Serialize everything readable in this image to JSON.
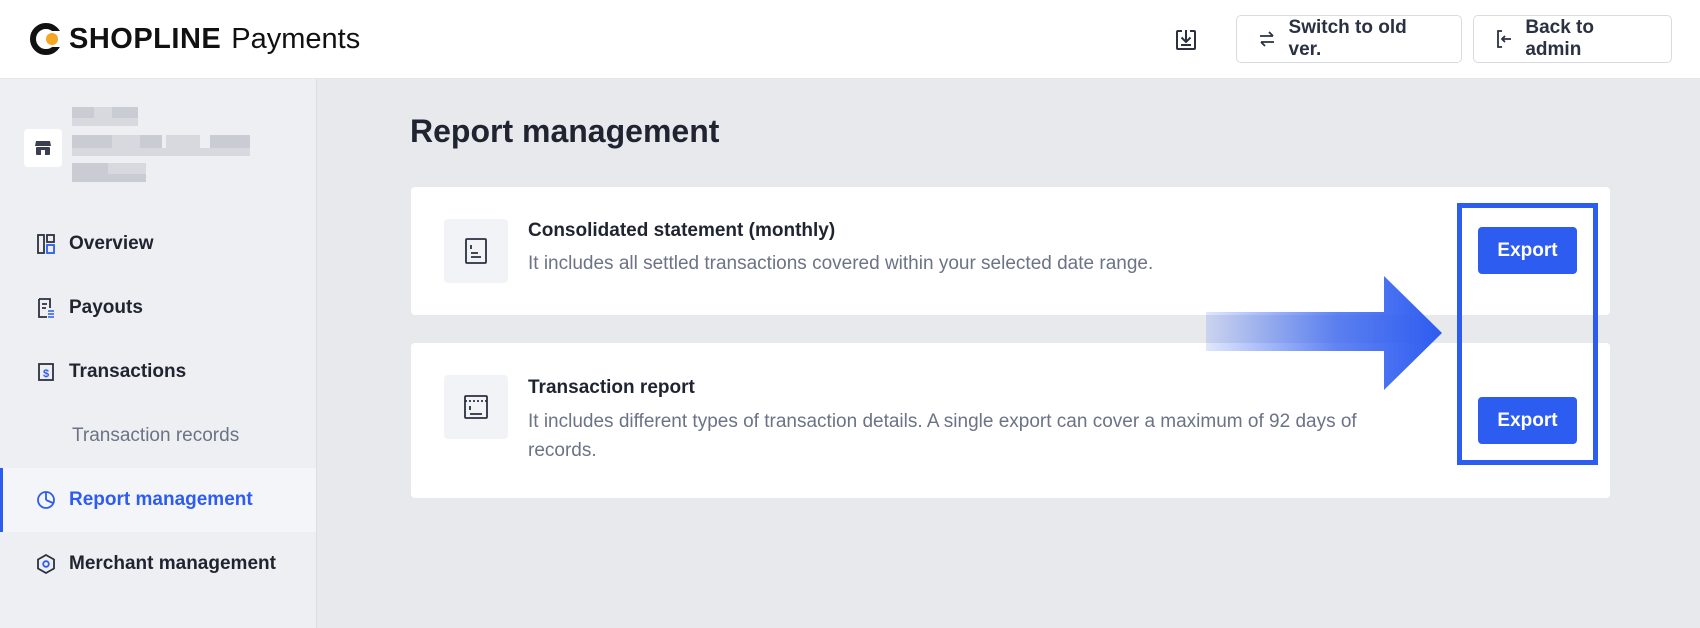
{
  "header": {
    "brand": "SHOPLINE",
    "product": "Payments",
    "switch_label": "Switch to old ver.",
    "back_label": "Back to admin"
  },
  "sidebar": {
    "items": [
      {
        "label": "Overview",
        "icon": "overview-icon"
      },
      {
        "label": "Payouts",
        "icon": "payouts-icon"
      },
      {
        "label": "Transactions",
        "icon": "transactions-icon"
      },
      {
        "label": "Transaction records",
        "icon": null
      },
      {
        "label": "Report management",
        "icon": "report-icon",
        "active": true
      },
      {
        "label": "Merchant management",
        "icon": "merchant-icon"
      }
    ]
  },
  "main": {
    "title": "Report management",
    "reports": [
      {
        "title": "Consolidated statement (monthly)",
        "description": "It includes all settled transactions covered within your selected date range.",
        "action": "Export"
      },
      {
        "title": "Transaction report",
        "description": "It includes different types of transaction details. A single export can cover a maximum of 92 days of records.",
        "action": "Export"
      }
    ]
  },
  "colors": {
    "accent": "#2d5cf0",
    "logo_orange": "#f5a623"
  }
}
